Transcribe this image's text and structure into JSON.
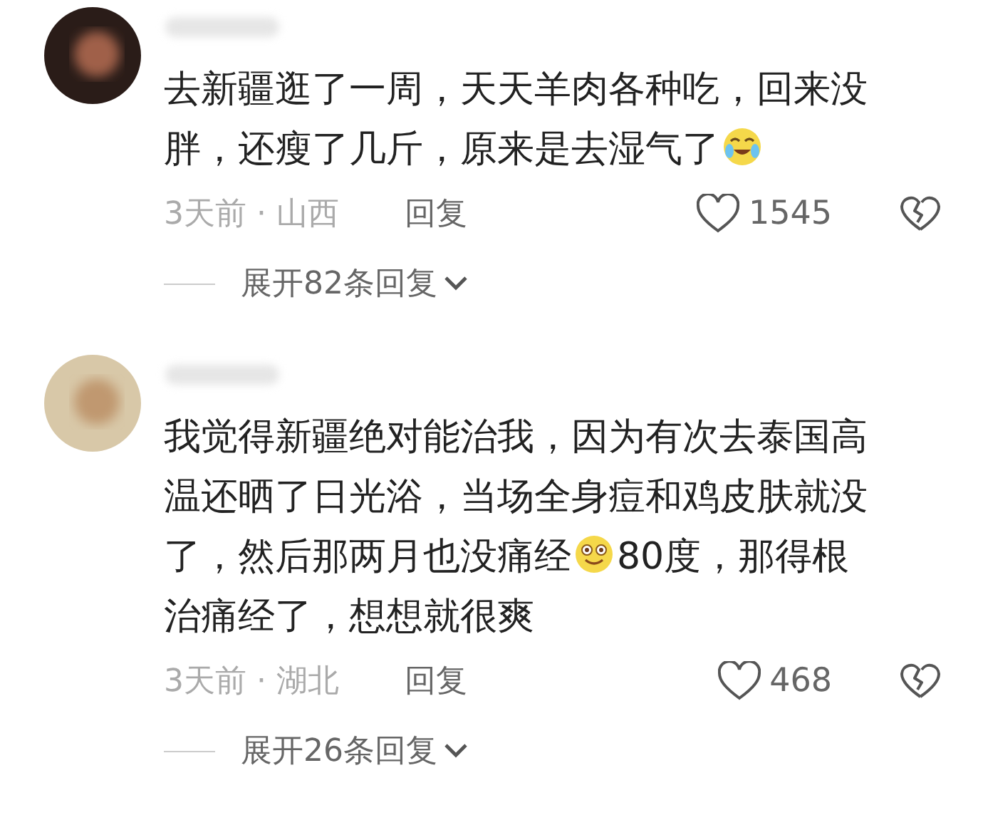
{
  "comments": [
    {
      "content": [
        {
          "kind": "text",
          "text": "去新疆逛了一周，天天羊肉各种吃，回来没胖，还瘦了几斤，原来是去湿气了"
        },
        {
          "kind": "emoji-tears"
        }
      ],
      "time": "3天前 · 山西",
      "reply": "回复",
      "likes": "1545",
      "expand": "展开82条回复"
    },
    {
      "content": [
        {
          "kind": "text",
          "text": "我觉得新疆绝对能治我，因为有次去泰国高温还晒了日光浴，当场全身痘和鸡皮肤就没了，然后那两月也没痛经"
        },
        {
          "kind": "emoji-smile"
        },
        {
          "kind": "text",
          "text": "80度，那得根治痛经了，想想就很爽"
        }
      ],
      "time": "3天前 · 湖北",
      "reply": "回复",
      "likes": "468",
      "expand": "展开26条回复"
    }
  ]
}
